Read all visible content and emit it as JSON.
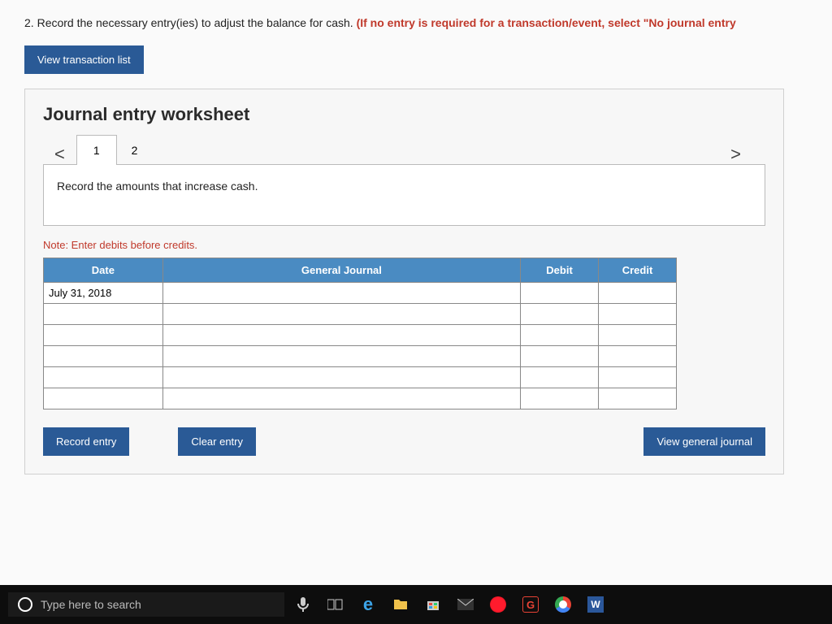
{
  "question": {
    "number": "2.",
    "text": "Record the necessary entry(ies) to adjust the balance for cash.",
    "hint": "(If no entry is required for a transaction/event, select \"No journal entry"
  },
  "buttons": {
    "view_transaction": "View transaction list",
    "record_entry": "Record entry",
    "clear_entry": "Clear entry",
    "view_general_journal": "View general journal"
  },
  "worksheet": {
    "title": "Journal entry worksheet",
    "tabs": [
      "1",
      "2"
    ],
    "instruction": "Record the amounts that increase cash.",
    "note": "Note: Enter debits before credits.",
    "columns": {
      "date": "Date",
      "journal": "General Journal",
      "debit": "Debit",
      "credit": "Credit"
    },
    "rows": [
      {
        "date": "July 31, 2018",
        "journal": "",
        "debit": "",
        "credit": ""
      },
      {
        "date": "",
        "journal": "",
        "debit": "",
        "credit": ""
      },
      {
        "date": "",
        "journal": "",
        "debit": "",
        "credit": ""
      },
      {
        "date": "",
        "journal": "",
        "debit": "",
        "credit": ""
      },
      {
        "date": "",
        "journal": "",
        "debit": "",
        "credit": ""
      },
      {
        "date": "",
        "journal": "",
        "debit": "",
        "credit": ""
      }
    ]
  },
  "nav": {
    "prev": "<",
    "next": ">"
  },
  "taskbar": {
    "search_placeholder": "Type here to search",
    "word_label": "W",
    "g_label": "G"
  }
}
